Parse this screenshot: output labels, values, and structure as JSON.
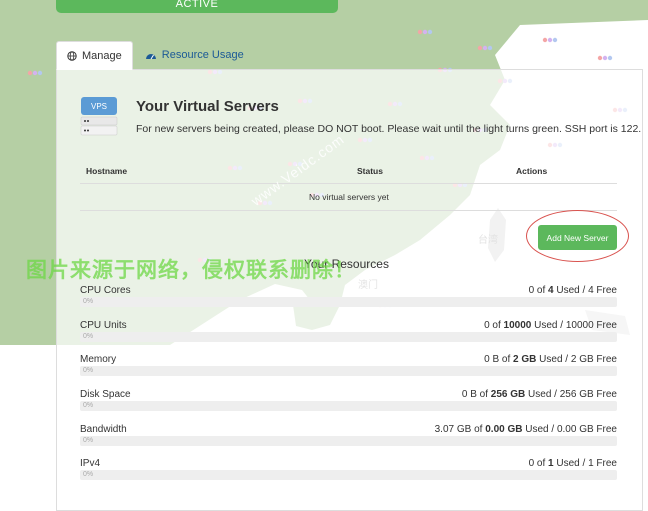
{
  "status_bar": {
    "label": "ACTIVE"
  },
  "tabs": [
    {
      "label": "Manage",
      "icon": "globe-icon",
      "active": true
    },
    {
      "label": "Resource Usage",
      "icon": "dashboard-icon",
      "active": false
    }
  ],
  "servers": {
    "title": "Your Virtual Servers",
    "icon_label": "VPS",
    "notice": "For new servers being created, please DO NOT boot. Please wait until the light turns green. SSH port is 122.",
    "columns": {
      "hostname": "Hostname",
      "status": "Status",
      "actions": "Actions"
    },
    "empty_text": "No virtual servers yet",
    "add_button": "Add New Server"
  },
  "resources": {
    "title": "Your Resources",
    "items": [
      {
        "name": "CPU Cores",
        "used": "0",
        "total": "4",
        "used_label": "Used",
        "sep": "/",
        "free": "4 Free",
        "fraction": 0
      },
      {
        "name": "CPU Units",
        "used": "0",
        "total": "10000",
        "used_label": "Used",
        "sep": "/",
        "free": "10000 Free",
        "fraction": 0
      },
      {
        "name": "Memory",
        "used": "0 B",
        "total": "2 GB",
        "used_label": "Used",
        "sep": "/",
        "free": "2 GB Free",
        "fraction": 0
      },
      {
        "name": "Disk Space",
        "used": "0 B",
        "total": "256 GB",
        "used_label": "Used",
        "sep": "/",
        "free": "256 GB Free",
        "fraction": 0
      },
      {
        "name": "Bandwidth",
        "used": "3.07 GB",
        "total": "0.00 GB",
        "used_label": "Used",
        "sep": "/",
        "free": "0.00 GB Free",
        "fraction": 0
      },
      {
        "name": "IPv4",
        "used": "0",
        "total": "1",
        "used_label": "Used",
        "sep": "/",
        "free": "1 Free",
        "fraction": 0
      }
    ],
    "of_word": "of",
    "bar_label": "0%"
  },
  "map_labels": {
    "taiwan": "台湾",
    "macau": "澳门"
  },
  "watermark": {
    "cn": "图片来源于网络，侵权联系删除！",
    "url": "www.Veidc.com"
  },
  "colors": {
    "accent_green": "#5cb85c",
    "link_blue": "#1c5a96",
    "annotation_red": "#d9534f",
    "map_green": "#b5cfa4"
  }
}
